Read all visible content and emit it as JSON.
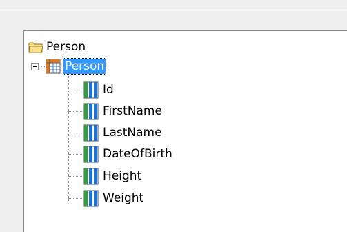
{
  "tree": {
    "root": {
      "label": "Person",
      "icon": "folder-icon"
    },
    "table": {
      "label": "Person",
      "icon": "table-icon",
      "selected": true,
      "expanded": true
    },
    "columns": [
      {
        "label": "Id",
        "icon": "column-icon"
      },
      {
        "label": "FirstName",
        "icon": "column-icon"
      },
      {
        "label": "LastName",
        "icon": "column-icon"
      },
      {
        "label": "DateOfBirth",
        "icon": "column-icon"
      },
      {
        "label": "Height",
        "icon": "column-icon"
      },
      {
        "label": "Weight",
        "icon": "column-icon"
      }
    ]
  },
  "colors": {
    "selection": "#3399ff",
    "folder": "#f5d36b",
    "column_blue": "#1f6fd1",
    "column_green": "#2f9e3a"
  }
}
